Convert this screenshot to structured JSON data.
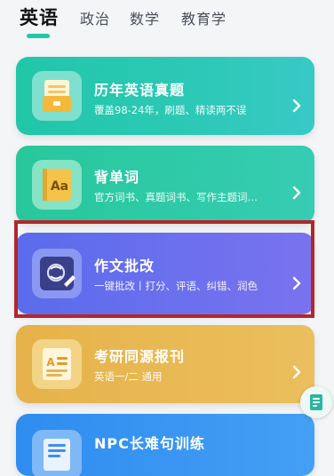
{
  "tabs": [
    {
      "label": "英语",
      "active": true
    },
    {
      "label": "政治",
      "active": false
    },
    {
      "label": "数学",
      "active": false
    },
    {
      "label": "教育学",
      "active": false
    }
  ],
  "cards": [
    {
      "title": "历年英语真题",
      "subtitle": "覆盖98-24年，刷题、精读两不误",
      "icon": "document-icon"
    },
    {
      "title": "背单词",
      "subtitle": "官方词书、真题词书、写作主题词…",
      "icon": "vocabulary-book-icon"
    },
    {
      "title": "作文批改",
      "subtitle": "一键批改丨打分、评语、纠错、润色",
      "icon": "essay-correction-icon"
    },
    {
      "title": "考研同源报刊",
      "subtitle": "英语一/二 通用",
      "icon": "newspaper-icon"
    },
    {
      "title": "NPC长难句训练",
      "subtitle": "",
      "icon": "sentence-training-icon"
    }
  ],
  "colors": {
    "accent": "#23c7a8",
    "highlight_border": "#b3262a"
  },
  "floating_button": {
    "icon": "notes-icon"
  }
}
